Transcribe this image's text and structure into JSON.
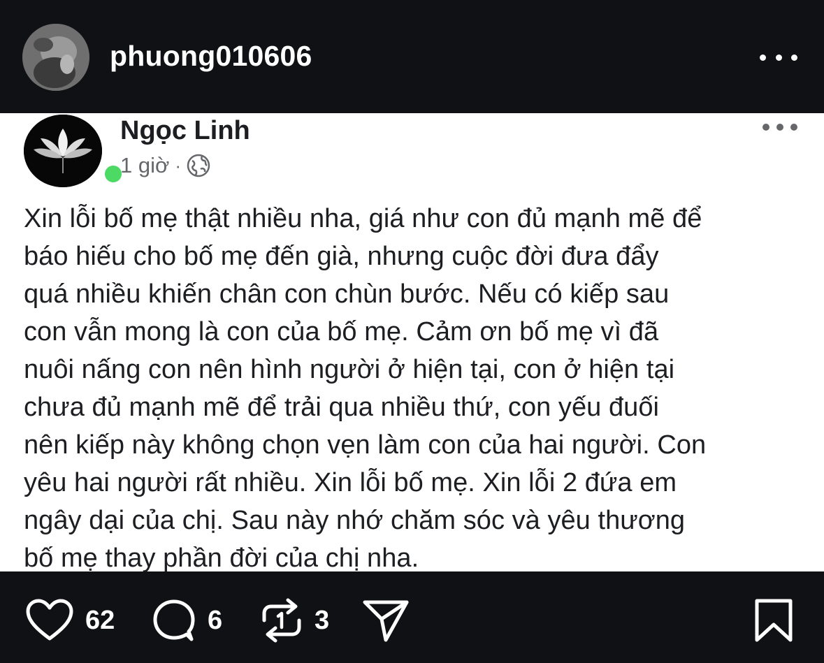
{
  "header": {
    "username": "phuong010606",
    "more_icon": "more-horizontal-icon"
  },
  "post": {
    "author": "Ngọc Linh",
    "time": "1 giờ",
    "separator": "·",
    "privacy_icon": "globe-icon",
    "online_status_color": "#4cd964",
    "lines": [
      "Xin lỗi bố mẹ thật nhiều nha, giá như con đủ mạnh mẽ để",
      "báo hiếu cho bố mẹ đến già, nhưng cuộc đời đưa đẩy",
      "quá nhiều khiến chân con chùn bước. Nếu có kiếp sau",
      "con vẫn mong là con của bố mẹ. Cảm ơn bố mẹ vì đã",
      "nuôi nấng con nên hình người ở hiện tại, con ở hiện tại",
      "chưa đủ mạnh mẽ để trải qua nhiều thứ, con yếu đuối",
      "nên kiếp này không chọn vẹn làm con của hai người. Con",
      "yêu hai người rất nhiều. Xin lỗi bố mẹ. Xin lỗi 2 đứa em",
      "ngây dại của chị. Sau này nhớ chăm sóc và yêu thương",
      "bố mẹ thay phần đời của chị nha."
    ]
  },
  "actions": {
    "likes": "62",
    "comments": "6",
    "reposts": "3",
    "icons": [
      "heart-icon",
      "comment-icon",
      "repost-icon",
      "send-icon",
      "bookmark-icon"
    ]
  },
  "colors": {
    "background": "#101114",
    "card": "#ffffff",
    "text_primary": "#1c1e21",
    "text_secondary": "#65676b"
  }
}
